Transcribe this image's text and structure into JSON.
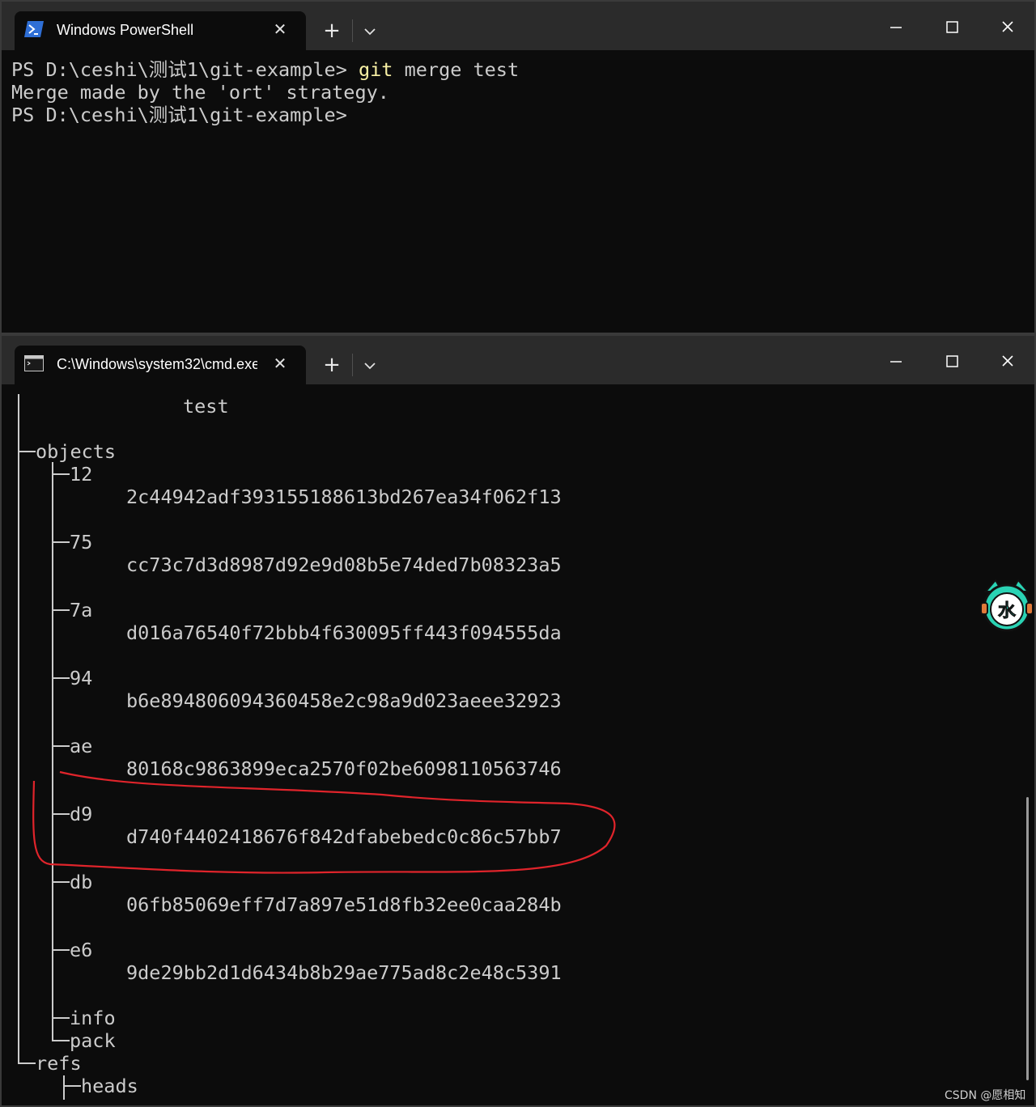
{
  "powershell_window": {
    "tab_title": "Windows PowerShell",
    "tab_icon": "powershell-icon",
    "new_tab_label": "+",
    "terminal": {
      "line1_prompt": "PS D:\\ceshi\\测试1\\git-example>",
      "line1_cmd": "git",
      "line1_args": "merge test",
      "line2": "Merge made by the 'ort' strategy.",
      "line3": "PS D:\\ceshi\\测试1\\git-example>"
    }
  },
  "cmd_window": {
    "tab_title": "C:\\Windows\\system32\\cmd.exe",
    "tab_icon": "cmd-icon",
    "new_tab_label": "+",
    "tree": {
      "test_label": "test",
      "objects_label": "objects",
      "object_dirs": [
        {
          "dir": "12",
          "hash": "2c44942adf393155188613bd267ea34f062f13"
        },
        {
          "dir": "75",
          "hash": "cc73c7d3d8987d92e9d08b5e74ded7b08323a5"
        },
        {
          "dir": "7a",
          "hash": "d016a76540f72bbb4f630095ff443f094555da"
        },
        {
          "dir": "94",
          "hash": "b6e894806094360458e2c98a9d023aeee32923"
        },
        {
          "dir": "ae",
          "hash": "80168c9863899eca2570f02be6098110563746"
        },
        {
          "dir": "d9",
          "hash": "d740f4402418676f842dfabebedc0c86c57bb7"
        },
        {
          "dir": "db",
          "hash": "06fb85069eff7d7a897e51d8fb32ee0caa284b"
        },
        {
          "dir": "e6",
          "hash": "9de29bb2d1d6434b8b29ae775ad8c2e48c5391"
        }
      ],
      "info_label": "info",
      "pack_label": "pack",
      "refs_label": "refs",
      "heads_label": "heads"
    }
  },
  "annotation": {
    "shape": "hand-drawn ellipse around d9 entry",
    "color": "#e0242b"
  },
  "watermark": "CSDN @愿相知",
  "colors": {
    "terminal_bg": "#0c0c0c",
    "text": "#cccccc",
    "command_highlight": "#f9f1a5",
    "titlebar": "#2b2b2b"
  }
}
